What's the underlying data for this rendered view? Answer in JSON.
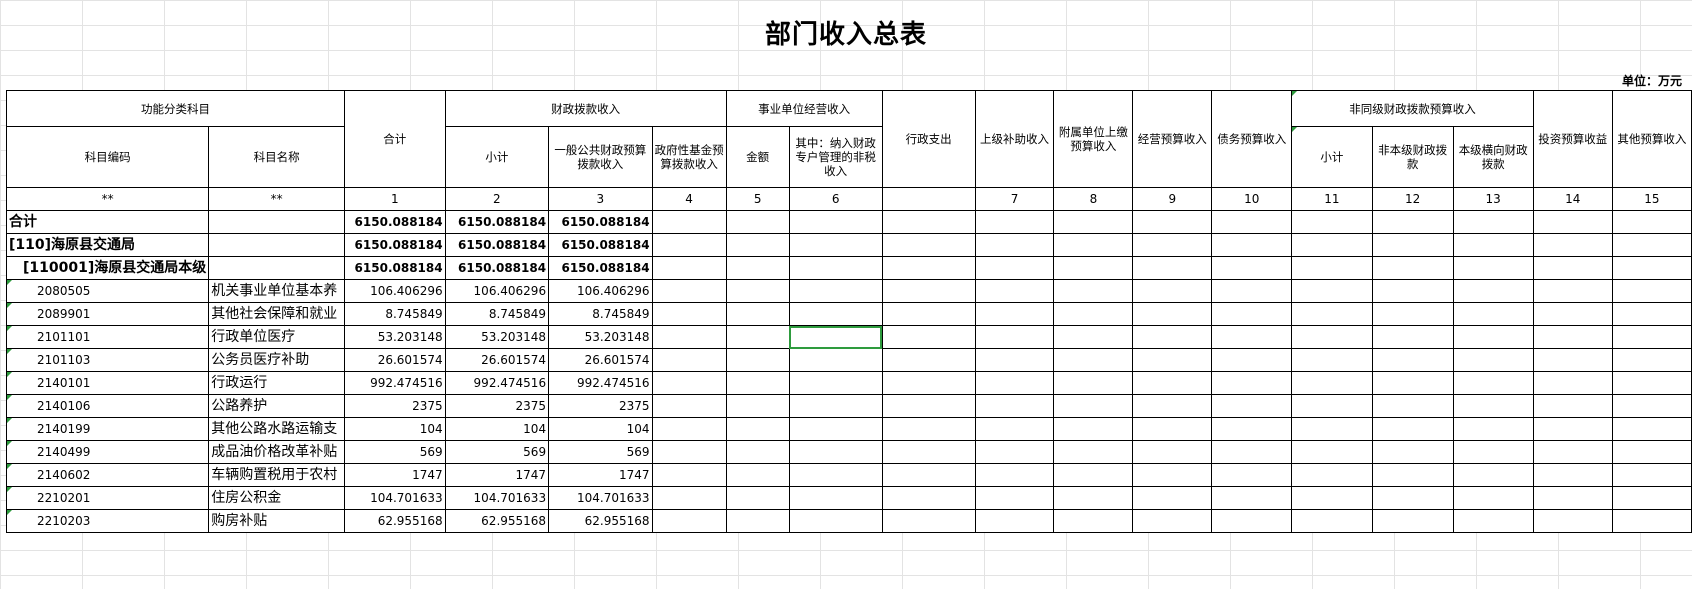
{
  "sheet": {
    "title": "部门收入总表",
    "unit": "单位：万元",
    "colors": {
      "selection_border": "#2e9b3e",
      "gridline": "#e3e3e3"
    }
  },
  "header": {
    "group_func": "功能分类科目",
    "code": "科目编码",
    "name": "科目名称",
    "total": "合计",
    "group_fiscal": "财政拨款收入",
    "subtotal": "小计",
    "general_budget": "一般公共财政预算拨款收入",
    "gov_fund": "政府性基金预算拨款收入",
    "group_business": "事业单位经营收入",
    "amount": "金额",
    "special_non_tax": "其中：纳入财政专户管理的非税收入",
    "admin_expense": "行政支出",
    "superior_subsidy": "上级补助收入",
    "affiliated": "附属单位上缴预算收入",
    "operating": "经营预算收入",
    "debt": "债务预算收入",
    "group_nonsame": "非同级财政拨款预算收入",
    "nonsame_subtotal": "小计",
    "non_local_fiscal": "非本级财政拨款",
    "local_horizontal": "本级横向财政拨款",
    "investment": "投资预算收益",
    "other": "其他预算收入"
  },
  "index_row": [
    "**",
    "**",
    "1",
    "2",
    "3",
    "4",
    "5",
    "6",
    "",
    "7",
    "8",
    "9",
    "10",
    "11",
    "12",
    "13",
    "14",
    "15"
  ],
  "rows": [
    {
      "code": "合计",
      "name": "",
      "total": "6150.088184",
      "subtotal": "6150.088184",
      "general": "6150.088184",
      "style": "lvl1"
    },
    {
      "code": "[110]海原县交通局",
      "name": "",
      "total": "6150.088184",
      "subtotal": "6150.088184",
      "general": "6150.088184",
      "style": "lvl1"
    },
    {
      "code": "[110001]海原县交通局本级",
      "name": "",
      "total": "6150.088184",
      "subtotal": "6150.088184",
      "general": "6150.088184",
      "style": "lvl2"
    },
    {
      "code": "2080505",
      "name": "机关事业单位基本养",
      "total": "106.406296",
      "subtotal": "106.406296",
      "general": "106.406296",
      "style": "item"
    },
    {
      "code": "2089901",
      "name": "其他社会保障和就业",
      "total": "8.745849",
      "subtotal": "8.745849",
      "general": "8.745849",
      "style": "item"
    },
    {
      "code": "2101101",
      "name": "行政单位医疗",
      "total": "53.203148",
      "subtotal": "53.203148",
      "general": "53.203148",
      "style": "item"
    },
    {
      "code": "2101103",
      "name": "公务员医疗补助",
      "total": "26.601574",
      "subtotal": "26.601574",
      "general": "26.601574",
      "style": "item"
    },
    {
      "code": "2140101",
      "name": "行政运行",
      "total": "992.474516",
      "subtotal": "992.474516",
      "general": "992.474516",
      "style": "item"
    },
    {
      "code": "2140106",
      "name": "公路养护",
      "total": "2375",
      "subtotal": "2375",
      "general": "2375",
      "style": "item"
    },
    {
      "code": "2140199",
      "name": "其他公路水路运输支",
      "total": "104",
      "subtotal": "104",
      "general": "104",
      "style": "item"
    },
    {
      "code": "2140499",
      "name": "成品油价格改革补贴",
      "total": "569",
      "subtotal": "569",
      "general": "569",
      "style": "item"
    },
    {
      "code": "2140602",
      "name": "车辆购置税用于农村",
      "total": "1747",
      "subtotal": "1747",
      "general": "1747",
      "style": "item"
    },
    {
      "code": "2210201",
      "name": "住房公积金",
      "total": "104.701633",
      "subtotal": "104.701633",
      "general": "104.701633",
      "style": "item"
    },
    {
      "code": "2210203",
      "name": "购房补贴",
      "total": "62.955168",
      "subtotal": "62.955168",
      "general": "62.955168",
      "style": "item"
    }
  ]
}
